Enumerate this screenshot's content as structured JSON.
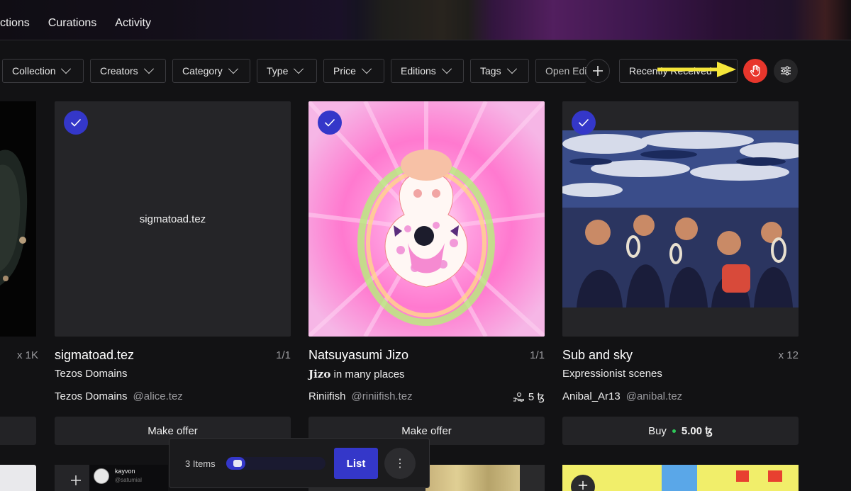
{
  "nav": {
    "items": [
      "ctions",
      "Curations",
      "Activity"
    ]
  },
  "filters": {
    "chips": [
      "Collection",
      "Creators",
      "Category",
      "Type",
      "Price",
      "Editions",
      "Tags",
      "Open Edi"
    ],
    "sort_value": "Recently Received"
  },
  "left_partial": {
    "count": "x 1K"
  },
  "cards": [
    {
      "title": "sigmatoad.tez",
      "edition": "1/1",
      "subtitle": "Tezos Domains",
      "creator": "Tezos Domains",
      "handle": "@alice.tez",
      "action": "Make offer",
      "thumb_text": "sigmatoad.tez",
      "meta_right": ""
    },
    {
      "title": "Natsuyasumi Jizo",
      "edition": "1/1",
      "subtitle_bold": "Jizo",
      "subtitle": " in many places",
      "creator": "Riniifish",
      "handle": "@riniifish.tez",
      "action": "Make offer",
      "meta_right": "5 ꜩ"
    },
    {
      "title": "Sub and sky",
      "edition": "x 12",
      "subtitle": "Expressionist scenes",
      "creator": "Anibal_Ar13",
      "handle": "@anibal.tez",
      "action": "Buy",
      "price": "5.00 ꜩ",
      "meta_right": ""
    }
  ],
  "bottom": {
    "profile_name": "kayvon",
    "profile_handle": "@satumial"
  },
  "list_bar": {
    "items": "3 Items",
    "list_label": "List",
    "more": "⋮",
    "slider_level": 0.12
  },
  "colors": {
    "accent": "#3437c9",
    "hand_button": "#e8362c",
    "arrow": "#f5e63a"
  }
}
